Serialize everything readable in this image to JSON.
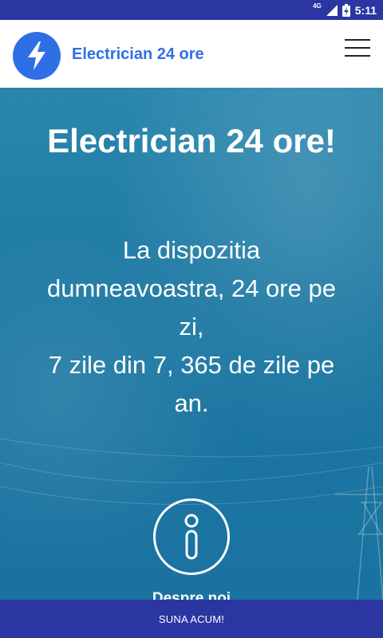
{
  "status_bar": {
    "network": "4G",
    "time": "5:11"
  },
  "header": {
    "brand": "Electrician 24 ore",
    "logo_icon": "lightning-bolt-icon",
    "menu_icon": "hamburger-menu-icon"
  },
  "hero": {
    "title": "Electrician 24 ore!",
    "subtitle_lines": [
      "La dispozitia",
      "dumneavoastra, 24 ore pe",
      "zi,",
      "7 zile din 7, 365 de zile pe",
      "an."
    ],
    "info_icon": "info-icon",
    "info_label": "Despre noi"
  },
  "call_bar": {
    "label": "SUNA ACUM!"
  },
  "colors": {
    "status_bar": "#2b36a3",
    "brand_blue": "#2f6fe6",
    "hero_bg": "#1f7fa8",
    "call_bar": "#2b36a3"
  }
}
